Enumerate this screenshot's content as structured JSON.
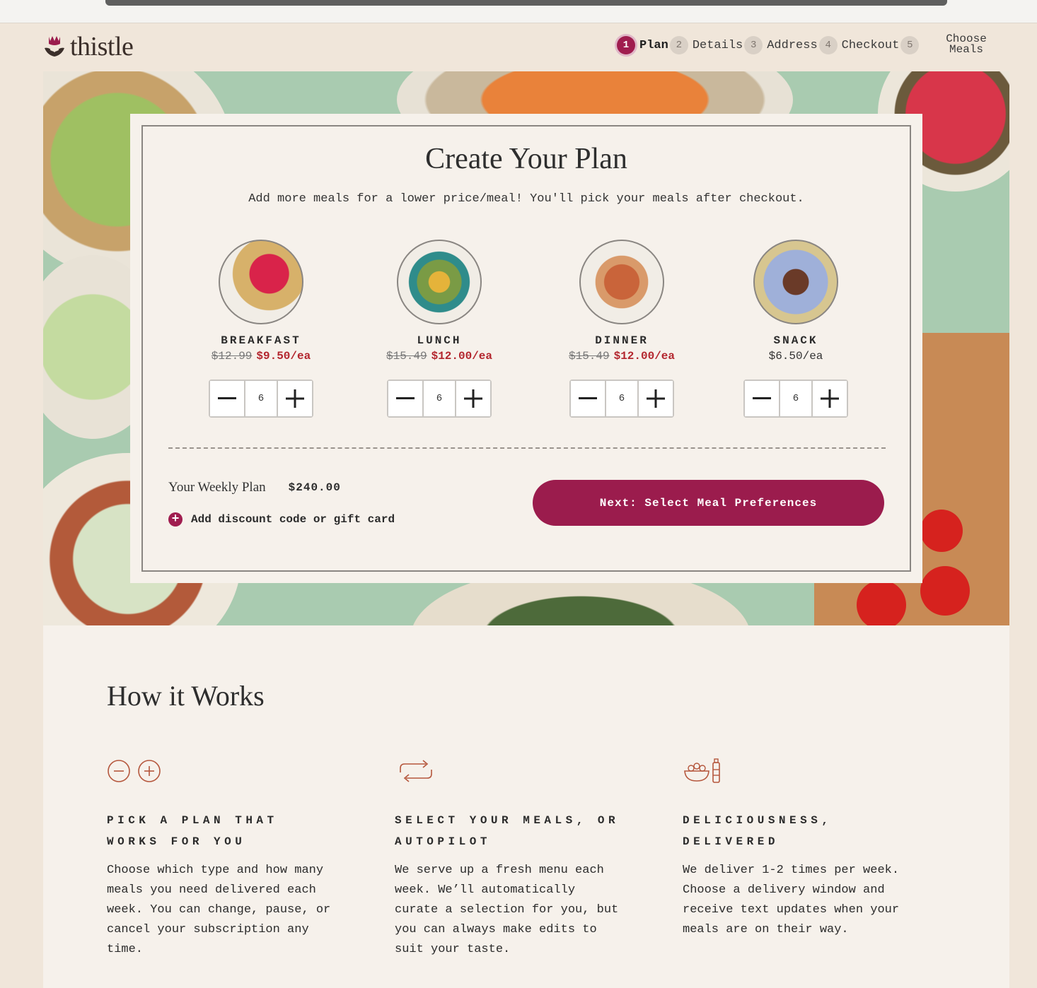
{
  "brand": {
    "name": "thistle",
    "accent": "#a01d4f"
  },
  "steps": [
    {
      "num": "1",
      "label": "Plan"
    },
    {
      "num": "2",
      "label": "Details"
    },
    {
      "num": "3",
      "label": "Address"
    },
    {
      "num": "4",
      "label": "Checkout"
    },
    {
      "num": "5",
      "label": ""
    }
  ],
  "choose_meals": "Choose Meals",
  "plan": {
    "title": "Create Your Plan",
    "subtitle": "Add more meals for a lower price/meal! You'll pick your meals after checkout.",
    "meals": [
      {
        "name": "BREAKFAST",
        "old_price": "$12.99",
        "price": "$9.50/ea",
        "qty": "6"
      },
      {
        "name": "LUNCH",
        "old_price": "$15.49",
        "price": "$12.00/ea",
        "qty": "6"
      },
      {
        "name": "DINNER",
        "old_price": "$15.49",
        "price": "$12.00/ea",
        "qty": "6"
      },
      {
        "name": "SNACK",
        "old_price": "",
        "price": "$6.50/ea",
        "qty": "6"
      }
    ],
    "weekly_label": "Your Weekly Plan",
    "weekly_total": "$240.00",
    "discount_label": "Add discount code or gift card",
    "next_label": "Next: Select Meal Preferences"
  },
  "how": {
    "title": "How it Works",
    "columns": [
      {
        "icon": "plus-minus-icon",
        "heading": "PICK A PLAN THAT WORKS FOR YOU",
        "text": "Choose which type and how many meals you need delivered each week. You can change, pause, or cancel your subscription any time."
      },
      {
        "icon": "repeat-icon",
        "heading": "SELECT YOUR MEALS, OR AUTOPILOT",
        "text": "We serve up a fresh menu each week. We’ll automatically curate a selection for you, but you can always make edits to suit your taste."
      },
      {
        "icon": "bowl-bottle-icon",
        "heading": "DELICIOUSNESS, DELIVERED",
        "text": "We deliver 1-2 times per week. Choose a delivery window and receive text updates when your meals are on their way."
      }
    ]
  }
}
